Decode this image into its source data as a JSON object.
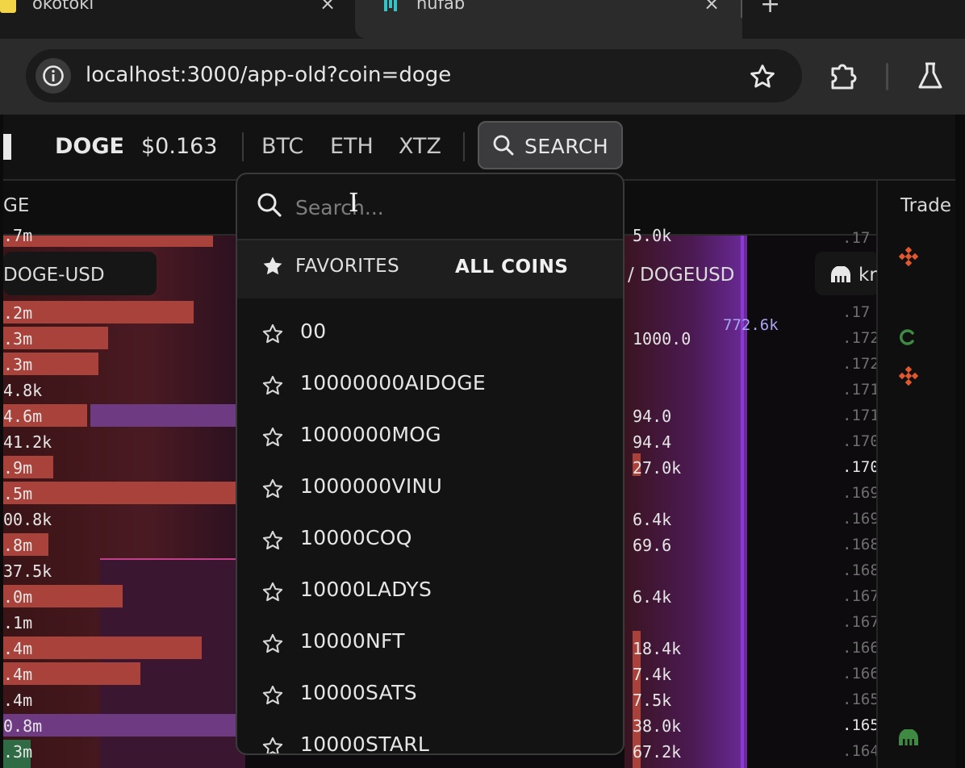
{
  "browser": {
    "tabs": [
      {
        "title": "okotoki",
        "close": "×"
      },
      {
        "title": "nufab",
        "close": "×"
      }
    ],
    "new_tab": "+",
    "url": "localhost:3000/app-old?coin=doge"
  },
  "nav": {
    "coin": "DOGE",
    "price": "$0.163",
    "links": [
      "BTC",
      "ETH",
      "XTZ"
    ],
    "search_label": "SEARCH"
  },
  "columns": {
    "left_header": "GE",
    "trades_header": "Trade"
  },
  "book": {
    "pair_left": "DOGE-USD",
    "pair_right": "/ DOGEUSD",
    "pair_far": "kr",
    "depth_value": "772.6k",
    "left_sizes": [
      ".7m",
      ".2m",
      ".3m",
      ".3m",
      "4.8k",
      "4.6m",
      "41.2k",
      ".9m",
      ".5m",
      "00.8k",
      ".8m",
      "37.5k",
      ".0m",
      ".1m",
      ".4m",
      ".4m",
      ".4m",
      "0.8m",
      ".3m"
    ],
    "right_sizes": [
      "5.0k",
      "1000.0",
      "94.0",
      "94.4",
      "27.0k",
      "6.4k",
      "69.6",
      "6.4k",
      "18.4k",
      "7.4k",
      "7.5k",
      "38.0k",
      "67.2k"
    ],
    "prices": [
      ".17",
      ".17",
      ".172",
      ".172",
      ".171",
      ".171",
      ".170",
      ".170",
      ".169",
      ".169",
      ".168",
      ".168",
      ".167",
      ".167",
      ".166",
      ".166",
      ".165",
      ".165",
      ".164"
    ],
    "trade_icons": [
      "binance-icon",
      "coinbase-icon",
      "binance-icon",
      "kraken-icon"
    ]
  },
  "dropdown": {
    "placeholder": "Search...",
    "tab_favorites": "FAVORITES",
    "tab_all": "ALL COINS",
    "coins": [
      "00",
      "10000000AIDOGE",
      "1000000MOG",
      "1000000VINU",
      "10000COQ",
      "10000LADYS",
      "10000NFT",
      "10000SATS",
      "10000STARL"
    ]
  },
  "colors": {
    "bid_bar": "#a8423a",
    "ask_glow": "#7a2fa0",
    "depth_text": "#a9a4f5",
    "binance": "#e2572c",
    "coinbase": "#3f8a43",
    "kraken": "#3f8a43"
  }
}
